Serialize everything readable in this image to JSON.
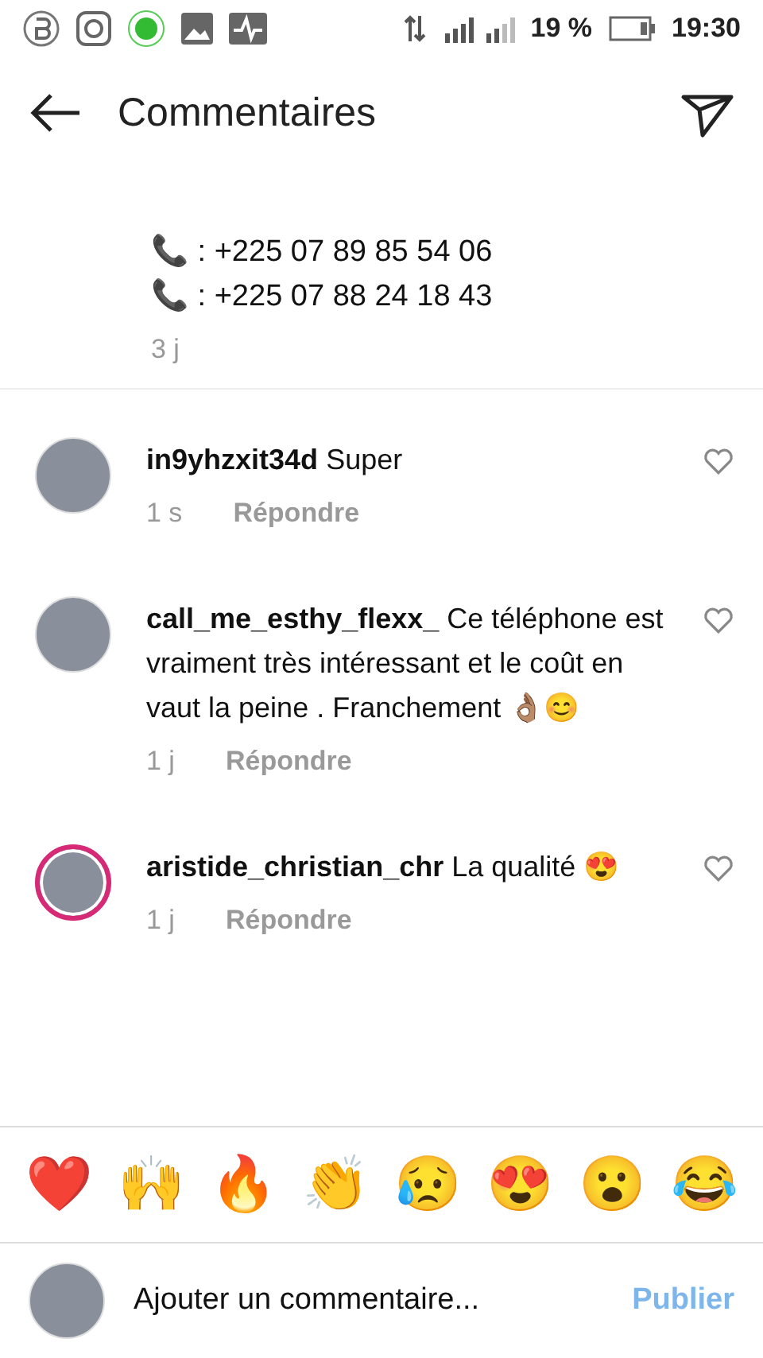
{
  "status_bar": {
    "battery_text": "19 %",
    "time": "19:30"
  },
  "header": {
    "title": "Commentaires"
  },
  "top_comment": {
    "phones": [
      "📞 : +225 07 89 85 54 06",
      "📞 : +225 07 88 24 18 43"
    ],
    "time": "3 j"
  },
  "comments": [
    {
      "username": "in9yhzxit34d",
      "text": "Super",
      "time": "1 s",
      "reply": "Répondre",
      "story_ring": false
    },
    {
      "username": "call_me_esthy_flexx_",
      "text": "Ce téléphone est vraiment très intéressant et le coût en vaut la peine . Franchement 👌🏽😊",
      "time": "1 j",
      "reply": "Répondre",
      "story_ring": false
    },
    {
      "username": "aristide_christian_chr",
      "text": "La qualité 😍",
      "time": "1 j",
      "reply": "Répondre",
      "story_ring": true
    }
  ],
  "reactions": [
    "❤️",
    "🙌",
    "🔥",
    "👏",
    "😥",
    "😍",
    "😮",
    "😂"
  ],
  "composer": {
    "placeholder": "Ajouter un commentaire...",
    "post_label": "Publier",
    "post_disabled": true
  }
}
